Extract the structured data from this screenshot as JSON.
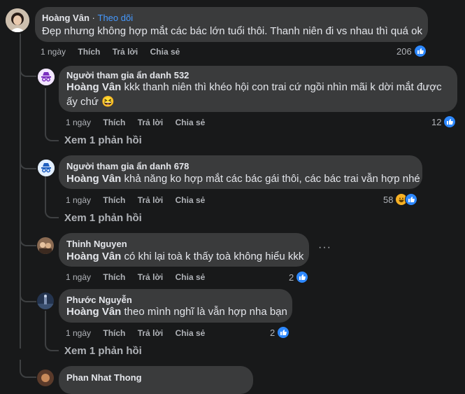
{
  "comments": [
    {
      "author": "Hoàng Vân",
      "follow_label": "Theo dõi",
      "separator": "·",
      "text": "Đẹp nhưng không hợp mắt các bác lớn tuổi thôi. Thanh niên đi vs nhau thì quá ok",
      "time": "1 ngày",
      "like_label": "Thích",
      "reply_label": "Trả lời",
      "share_label": "Chia sẻ",
      "reaction_count": "206"
    },
    {
      "author": "Người tham gia ẩn danh 532",
      "mention": "Hoàng Vân",
      "text_line1": " kkk thanh niên thì khéo hội con trai cứ ngồi nhìn mãi k dời mắt được",
      "text_line2": "ấy chứ",
      "emoji": "😆",
      "time": "1 ngày",
      "like_label": "Thích",
      "reply_label": "Trả lời",
      "share_label": "Chia sẻ",
      "reaction_count": "12",
      "view_replies": "Xem 1 phản hồi"
    },
    {
      "author": "Người tham gia ẩn danh 678",
      "mention": "Hoàng Vân",
      "text": " khả năng ko hợp mắt các bác gái thôi, các bác trai vẫn hợp nhé",
      "time": "1 ngày",
      "like_label": "Thích",
      "reply_label": "Trả lời",
      "share_label": "Chia sẻ",
      "reaction_count": "58",
      "view_replies": "Xem 1 phản hồi"
    },
    {
      "author": "Thinh Nguyen",
      "mention": "Hoàng Vân",
      "text": " có khi lại toà k thấy toà không hiểu kkk",
      "more": "···",
      "time": "1 ngày",
      "like_label": "Thích",
      "reply_label": "Trả lời",
      "share_label": "Chia sẻ",
      "reaction_count": "2"
    },
    {
      "author": "Phước Nguyễn",
      "mention": "Hoàng Vân",
      "text": " theo mình nghĩ là vẫn hợp nha bạn",
      "time": "1 ngày",
      "like_label": "Thích",
      "reply_label": "Trả lời",
      "share_label": "Chia sẻ",
      "reaction_count": "2",
      "view_replies": "Xem 1 phản hồi"
    },
    {
      "author": "Phan Nhat Thong"
    }
  ],
  "colors": {
    "background": "#18191a",
    "bubble": "#3a3b3c",
    "link": "#4599ff",
    "like": "#2d88ff",
    "muted": "#b0b3b8"
  }
}
